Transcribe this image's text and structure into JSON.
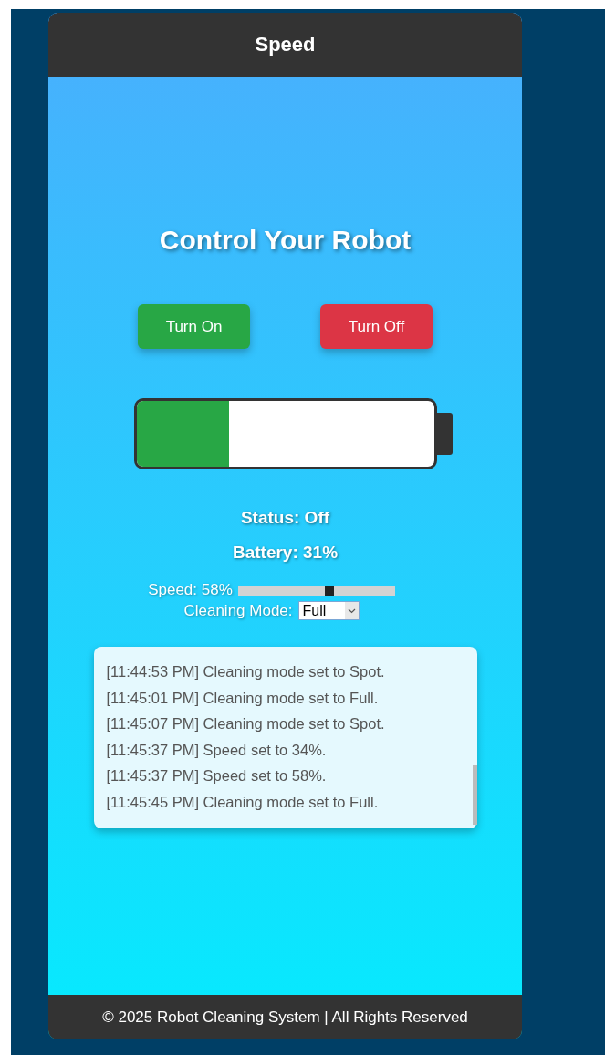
{
  "header": {
    "title": "Speed"
  },
  "heading": "Control Your Robot",
  "buttons": [
    {
      "kind": "on",
      "label": "Turn On"
    },
    {
      "kind": "off",
      "label": "Turn Off"
    }
  ],
  "battery_meter": {
    "level": 0.31
  },
  "status": "Status: Off",
  "battery": "Battery: 31%",
  "speed": {
    "label": "Speed: 58%",
    "level": 0.58
  },
  "cleaning_mode": {
    "label": "Cleaning Mode:",
    "value": "Full"
  },
  "log": [
    "[11:44:53 PM] Cleaning mode set to Spot.",
    "[11:45:01 PM] Cleaning mode set to Full.",
    "[11:45:07 PM] Cleaning mode set to Spot.",
    "[11:45:37 PM] Speed set to 34%.",
    "[11:45:37 PM] Speed set to 58%.",
    "[11:45:45 PM] Cleaning mode set to Full."
  ],
  "footer": "© 2025 Robot Cleaning System | All Rights Reserved"
}
